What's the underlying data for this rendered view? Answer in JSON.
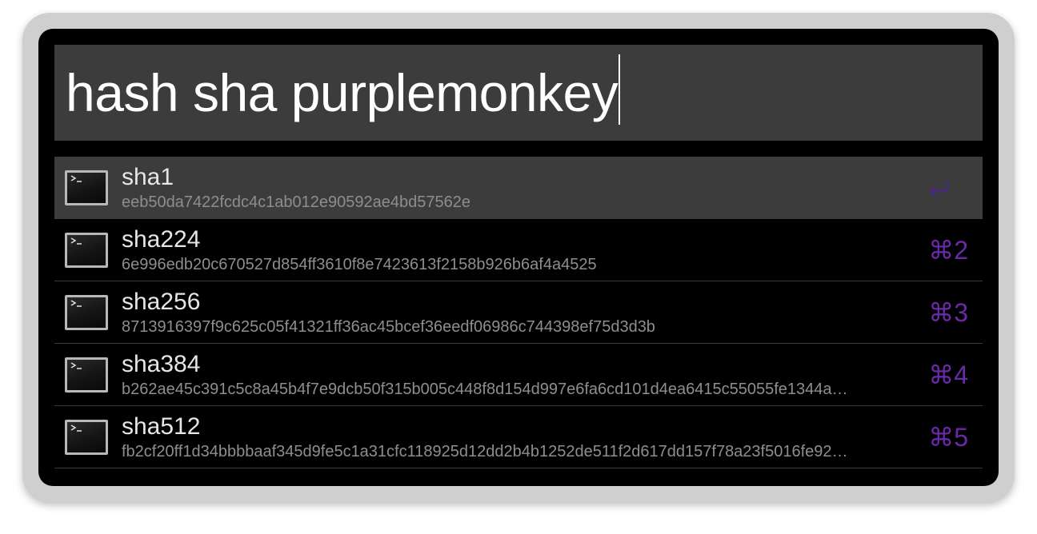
{
  "query": {
    "text": "hash sha purplemonkey"
  },
  "results": [
    {
      "title": "sha1",
      "subtitle": "eeb50da7422fcdc4c1ab012e90592ae4bd57562e",
      "shortcut": "",
      "shortcut_icon": "return-icon",
      "selected": true
    },
    {
      "title": "sha224",
      "subtitle": "6e996edb20c670527d854ff3610f8e7423613f2158b926b6af4a4525",
      "shortcut": "⌘2",
      "selected": false
    },
    {
      "title": "sha256",
      "subtitle": "8713916397f9c625c05f41321ff36ac45bcef36eedf06986c744398ef75d3d3b",
      "shortcut": "⌘3",
      "selected": false
    },
    {
      "title": "sha384",
      "subtitle": "b262ae45c391c5c8a45b4f7e9dcb50f315b005c448f8d154d997e6fa6cd101d4ea6415c55055fe1344a…",
      "shortcut": "⌘4",
      "selected": false
    },
    {
      "title": "sha512",
      "subtitle": "fb2cf20ff1d34bbbbaaf345d9fe5c1a31cfc118925d12dd2b4b1252de511f2d617dd157f78a23f5016fe92…",
      "shortcut": "⌘5",
      "selected": false
    }
  ],
  "colors": {
    "window_background": "#000000",
    "query_background": "#3c3c3c",
    "selected_row": "#3c3c3c",
    "shortcut_accent": "#6a2aa8",
    "title_text": "#e6e6e6",
    "subtitle_text": "#8e8e8e"
  },
  "icons": {
    "result_icon": "terminal-icon"
  }
}
